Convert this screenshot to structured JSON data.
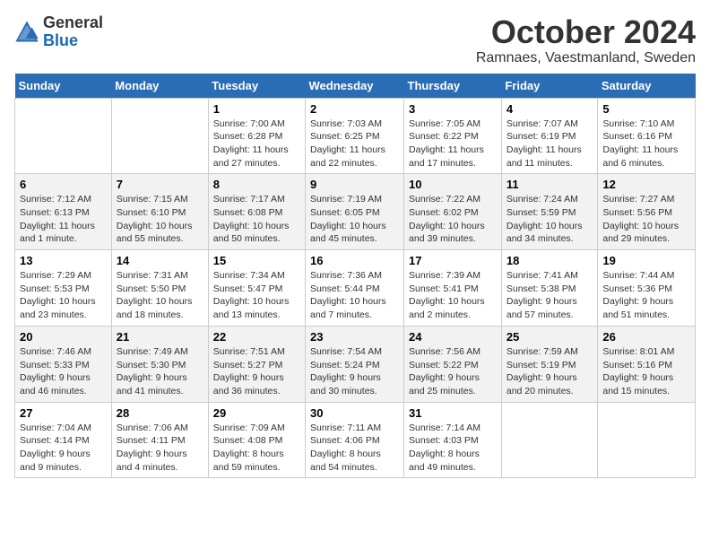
{
  "logo": {
    "general": "General",
    "blue": "Blue"
  },
  "title": "October 2024",
  "subtitle": "Ramnaes, Vaestmanland, Sweden",
  "days_of_week": [
    "Sunday",
    "Monday",
    "Tuesday",
    "Wednesday",
    "Thursday",
    "Friday",
    "Saturday"
  ],
  "weeks": [
    [
      {
        "day": "",
        "info": ""
      },
      {
        "day": "",
        "info": ""
      },
      {
        "day": "1",
        "info": "Sunrise: 7:00 AM\nSunset: 6:28 PM\nDaylight: 11 hours and 27 minutes."
      },
      {
        "day": "2",
        "info": "Sunrise: 7:03 AM\nSunset: 6:25 PM\nDaylight: 11 hours and 22 minutes."
      },
      {
        "day": "3",
        "info": "Sunrise: 7:05 AM\nSunset: 6:22 PM\nDaylight: 11 hours and 17 minutes."
      },
      {
        "day": "4",
        "info": "Sunrise: 7:07 AM\nSunset: 6:19 PM\nDaylight: 11 hours and 11 minutes."
      },
      {
        "day": "5",
        "info": "Sunrise: 7:10 AM\nSunset: 6:16 PM\nDaylight: 11 hours and 6 minutes."
      }
    ],
    [
      {
        "day": "6",
        "info": "Sunrise: 7:12 AM\nSunset: 6:13 PM\nDaylight: 11 hours and 1 minute."
      },
      {
        "day": "7",
        "info": "Sunrise: 7:15 AM\nSunset: 6:10 PM\nDaylight: 10 hours and 55 minutes."
      },
      {
        "day": "8",
        "info": "Sunrise: 7:17 AM\nSunset: 6:08 PM\nDaylight: 10 hours and 50 minutes."
      },
      {
        "day": "9",
        "info": "Sunrise: 7:19 AM\nSunset: 6:05 PM\nDaylight: 10 hours and 45 minutes."
      },
      {
        "day": "10",
        "info": "Sunrise: 7:22 AM\nSunset: 6:02 PM\nDaylight: 10 hours and 39 minutes."
      },
      {
        "day": "11",
        "info": "Sunrise: 7:24 AM\nSunset: 5:59 PM\nDaylight: 10 hours and 34 minutes."
      },
      {
        "day": "12",
        "info": "Sunrise: 7:27 AM\nSunset: 5:56 PM\nDaylight: 10 hours and 29 minutes."
      }
    ],
    [
      {
        "day": "13",
        "info": "Sunrise: 7:29 AM\nSunset: 5:53 PM\nDaylight: 10 hours and 23 minutes."
      },
      {
        "day": "14",
        "info": "Sunrise: 7:31 AM\nSunset: 5:50 PM\nDaylight: 10 hours and 18 minutes."
      },
      {
        "day": "15",
        "info": "Sunrise: 7:34 AM\nSunset: 5:47 PM\nDaylight: 10 hours and 13 minutes."
      },
      {
        "day": "16",
        "info": "Sunrise: 7:36 AM\nSunset: 5:44 PM\nDaylight: 10 hours and 7 minutes."
      },
      {
        "day": "17",
        "info": "Sunrise: 7:39 AM\nSunset: 5:41 PM\nDaylight: 10 hours and 2 minutes."
      },
      {
        "day": "18",
        "info": "Sunrise: 7:41 AM\nSunset: 5:38 PM\nDaylight: 9 hours and 57 minutes."
      },
      {
        "day": "19",
        "info": "Sunrise: 7:44 AM\nSunset: 5:36 PM\nDaylight: 9 hours and 51 minutes."
      }
    ],
    [
      {
        "day": "20",
        "info": "Sunrise: 7:46 AM\nSunset: 5:33 PM\nDaylight: 9 hours and 46 minutes."
      },
      {
        "day": "21",
        "info": "Sunrise: 7:49 AM\nSunset: 5:30 PM\nDaylight: 9 hours and 41 minutes."
      },
      {
        "day": "22",
        "info": "Sunrise: 7:51 AM\nSunset: 5:27 PM\nDaylight: 9 hours and 36 minutes."
      },
      {
        "day": "23",
        "info": "Sunrise: 7:54 AM\nSunset: 5:24 PM\nDaylight: 9 hours and 30 minutes."
      },
      {
        "day": "24",
        "info": "Sunrise: 7:56 AM\nSunset: 5:22 PM\nDaylight: 9 hours and 25 minutes."
      },
      {
        "day": "25",
        "info": "Sunrise: 7:59 AM\nSunset: 5:19 PM\nDaylight: 9 hours and 20 minutes."
      },
      {
        "day": "26",
        "info": "Sunrise: 8:01 AM\nSunset: 5:16 PM\nDaylight: 9 hours and 15 minutes."
      }
    ],
    [
      {
        "day": "27",
        "info": "Sunrise: 7:04 AM\nSunset: 4:14 PM\nDaylight: 9 hours and 9 minutes."
      },
      {
        "day": "28",
        "info": "Sunrise: 7:06 AM\nSunset: 4:11 PM\nDaylight: 9 hours and 4 minutes."
      },
      {
        "day": "29",
        "info": "Sunrise: 7:09 AM\nSunset: 4:08 PM\nDaylight: 8 hours and 59 minutes."
      },
      {
        "day": "30",
        "info": "Sunrise: 7:11 AM\nSunset: 4:06 PM\nDaylight: 8 hours and 54 minutes."
      },
      {
        "day": "31",
        "info": "Sunrise: 7:14 AM\nSunset: 4:03 PM\nDaylight: 8 hours and 49 minutes."
      },
      {
        "day": "",
        "info": ""
      },
      {
        "day": "",
        "info": ""
      }
    ]
  ]
}
